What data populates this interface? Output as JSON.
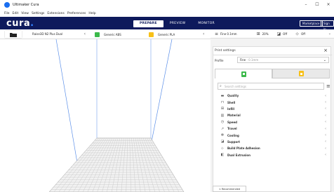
{
  "window": {
    "title": "Ultimaker Cura",
    "minimize": "–",
    "close": "×"
  },
  "menu": [
    "File",
    "Edit",
    "View",
    "Settings",
    "Extensions",
    "Preferences",
    "Help"
  ],
  "header": {
    "logo": "cura",
    "logo_dot": ".",
    "tabs": [
      "PREPARE",
      "PREVIEW",
      "MONITOR"
    ],
    "active_tab": "PREPARE",
    "marketplace": "Marketplace",
    "signin": "Sign in"
  },
  "printer_bar": {
    "printer_name": "Raise3D N2 Plus Dual",
    "extruders": [
      {
        "material": "Generic ABS",
        "color": "#3bb94a"
      },
      {
        "material": "Generic PLA",
        "color": "#f7c018"
      }
    ]
  },
  "settings_bar": {
    "profile": "Fine 0.1mm",
    "infill": "20%",
    "support": "Off",
    "adhesion": "Off"
  },
  "print_settings": {
    "title": "Print settings",
    "profile_label": "Profile",
    "profile_value": "Fine",
    "profile_sub": "- 0.1mm",
    "search_placeholder": "Search settings",
    "categories": [
      {
        "label": "Quality",
        "icon": "▬"
      },
      {
        "label": "Shell",
        "icon": "⊓"
      },
      {
        "label": "Infill",
        "icon": "⊞"
      },
      {
        "label": "Material",
        "icon": "▥"
      },
      {
        "label": "Speed",
        "icon": "◷"
      },
      {
        "label": "Travel",
        "icon": "↗"
      },
      {
        "label": "Cooling",
        "icon": "✻"
      },
      {
        "label": "Support",
        "icon": "◪"
      },
      {
        "label": "Build Plate Adhesion",
        "icon": "⊹"
      },
      {
        "label": "Dual Extrusion",
        "icon": "◧"
      }
    ]
  },
  "recommended_button": "< Recommended",
  "colors": {
    "header_bg": "#0e1a5c",
    "accent": "#196ef0"
  }
}
